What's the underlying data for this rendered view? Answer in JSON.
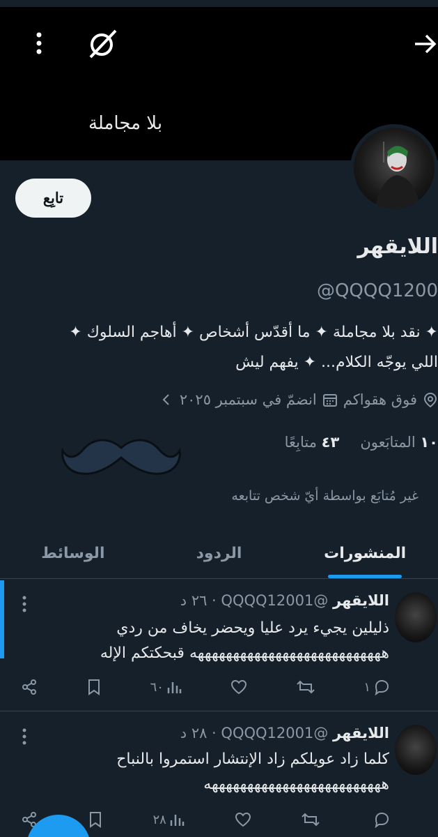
{
  "banner": {
    "title": "بلا مجاملة"
  },
  "profile": {
    "follow_label": "تابِع",
    "name": "اللايقهر",
    "handle": "@QQQQ1200",
    "bio_line1": "✦ نقد بلا مجاملة  ✦ ما أقدّس أشخاص  ✦ أهاجم السلوك ✦",
    "bio_line2": "اللي يوجّه الكلام...  ✦  يفهم ليش",
    "location": "فوق هقواكم",
    "joined": "انضمّ في سبتمبر ٢٠٢٥",
    "followers_count": "١٠",
    "followers_label": "المتابَعون",
    "following_count": "٤٣",
    "following_label": "متابِعًا",
    "not_followed": "غير مُتابَع بواسطة أيّ شخص تتابعه"
  },
  "tabs": [
    "المنشورات",
    "الردود",
    "الوسائط"
  ],
  "posts": [
    {
      "name": "اللايقهر",
      "handle": "@QQQQ12001",
      "time": "· ٢٦ د",
      "text": "ذليلين يجيء يرد عليا ويحضر يخاف من ردي هههههههههههههههههههههههههههه قبحكتكم الإله",
      "replies": "١",
      "views": "٦٠"
    },
    {
      "name": "اللايقهر",
      "handle": "@QQQQ12001",
      "time": "· ٢٨ د",
      "text": "كلما زاد عويلكم زاد الإنتشار استمروا بالنباح هههههههههههههههههههههههههه",
      "replies": "",
      "views": "٢٨"
    }
  ],
  "colors": {
    "accent": "#1d9bf0",
    "background": "#15202b",
    "muted": "#8b98a5"
  }
}
